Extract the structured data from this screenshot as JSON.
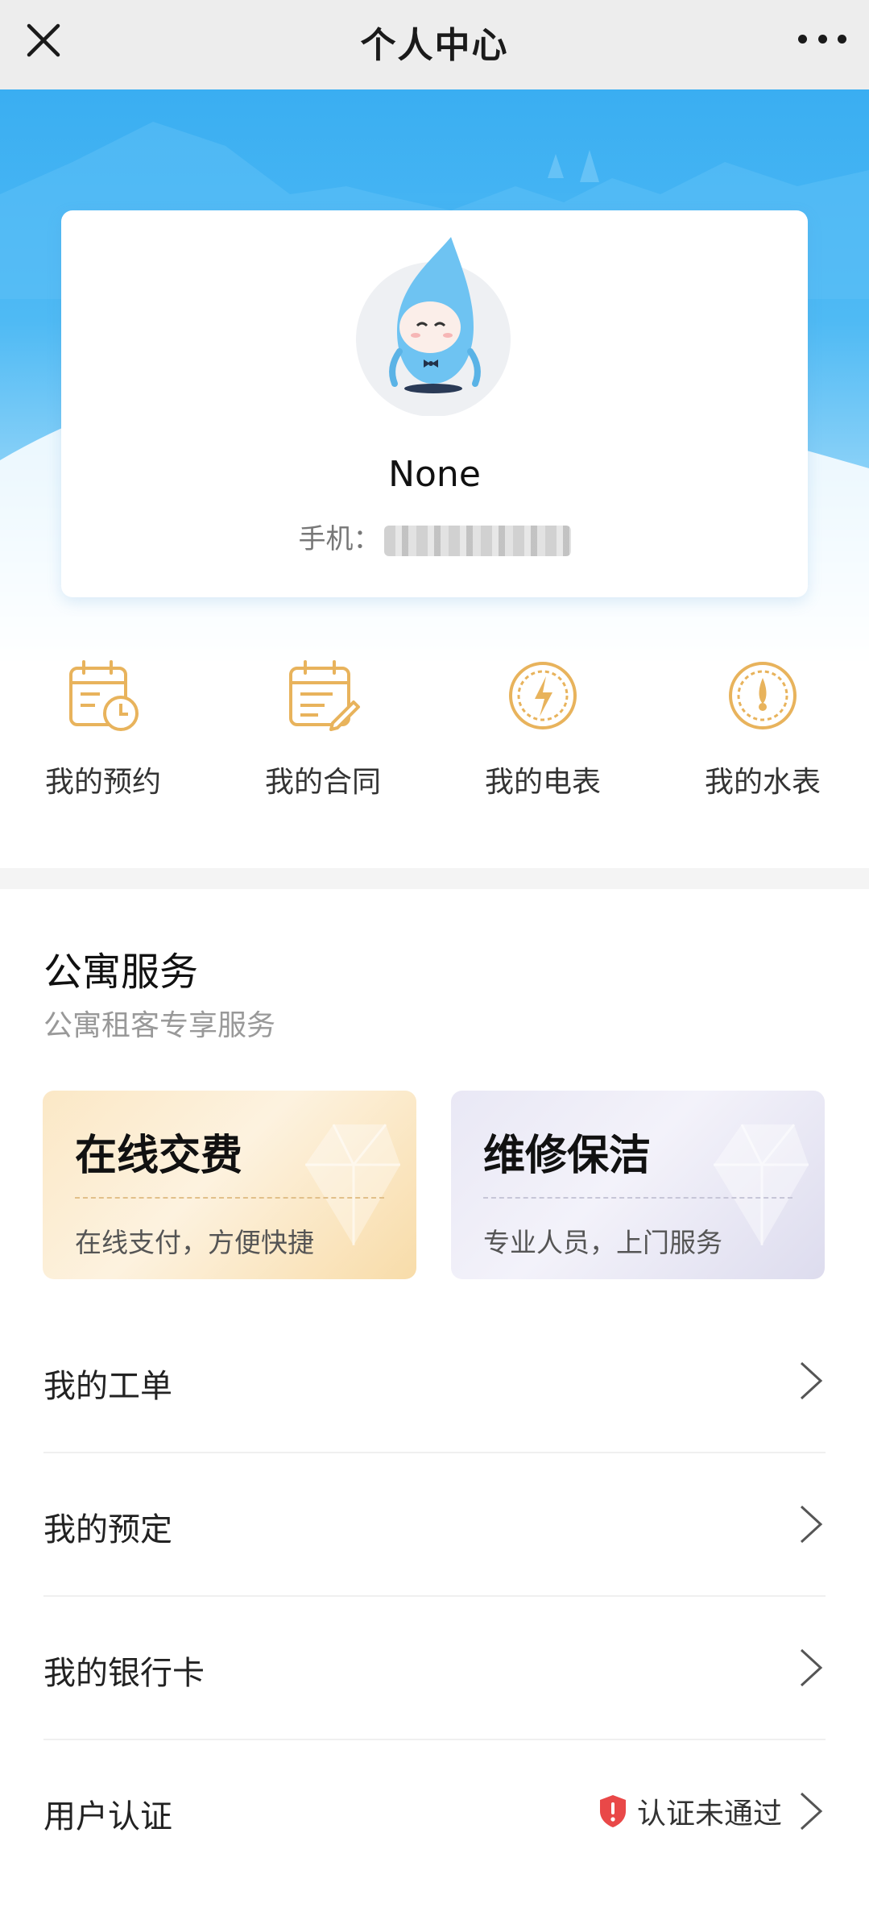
{
  "navbar": {
    "title": "个人中心",
    "close_icon": "close-icon",
    "more_icon": "more-icon"
  },
  "profile": {
    "name": "None",
    "phone_label": "手机：",
    "avatar_icon": "water-drop-mascot-avatar"
  },
  "quick_actions": [
    {
      "label": "我的预约",
      "icon": "calendar-clock-icon"
    },
    {
      "label": "我的合同",
      "icon": "calendar-edit-icon"
    },
    {
      "label": "我的电表",
      "icon": "electric-meter-icon"
    },
    {
      "label": "我的水表",
      "icon": "water-meter-icon"
    }
  ],
  "services": {
    "title": "公寓服务",
    "subtitle": "公寓租客专享服务",
    "cards": [
      {
        "title": "在线交费",
        "desc": "在线支付，方便快捷"
      },
      {
        "title": "维修保洁",
        "desc": "专业人员，上门服务"
      }
    ]
  },
  "list": [
    {
      "label": "我的工单"
    },
    {
      "label": "我的预定"
    },
    {
      "label": "我的银行卡"
    },
    {
      "label": "用户认证",
      "status": "认证未通过"
    }
  ],
  "colors": {
    "accent_gold": "#e8b35c",
    "hero_blue": "#3aaef2",
    "warning_red": "#e94848"
  }
}
